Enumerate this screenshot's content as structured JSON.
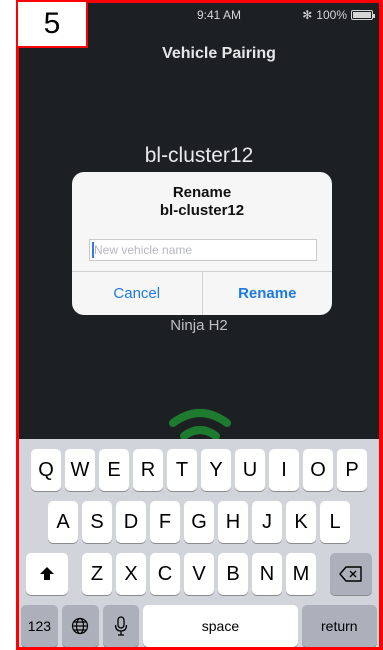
{
  "annotation": {
    "step_number": "5"
  },
  "status_bar": {
    "time": "9:41 AM",
    "bluetooth_symbol": "✻",
    "battery_percent": "100%"
  },
  "screen": {
    "title": "Vehicle Pairing",
    "device_name": "bl-cluster12",
    "device_model": "Ninja H2"
  },
  "dialog": {
    "title_line1": "Rename",
    "title_line2": "bl-cluster12",
    "input_placeholder": "New vehicle name",
    "input_value": "",
    "cancel_label": "Cancel",
    "rename_label": "Rename"
  },
  "keyboard": {
    "row1": [
      "Q",
      "W",
      "E",
      "R",
      "T",
      "Y",
      "U",
      "I",
      "O",
      "P"
    ],
    "row2": [
      "A",
      "S",
      "D",
      "F",
      "G",
      "H",
      "J",
      "K",
      "L"
    ],
    "row3": [
      "Z",
      "X",
      "C",
      "V",
      "B",
      "N",
      "M"
    ],
    "numbers_label": "123",
    "space_label": "space",
    "return_label": "return"
  },
  "icons": {
    "shift": "shift-icon",
    "backspace": "backspace-icon",
    "globe": "globe-icon",
    "microphone": "microphone-icon",
    "signal": "signal-icon",
    "bluetooth": "bluetooth-icon",
    "battery": "battery-icon"
  },
  "colors": {
    "frame_border": "#ff0000",
    "screen_background": "#1d2023",
    "accent_blue": "#1f7ae0",
    "signal_green": "#1e7a2f",
    "keyboard_background": "#d1d4da"
  }
}
